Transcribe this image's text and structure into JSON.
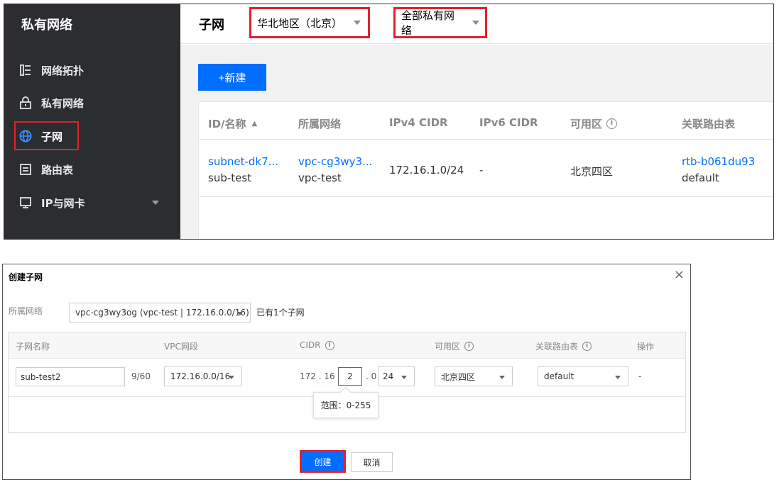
{
  "sidebar": {
    "title": "私有网络",
    "items": [
      {
        "label": "网络拓扑",
        "icon": "topology-icon"
      },
      {
        "label": "私有网络",
        "icon": "lock-icon"
      },
      {
        "label": "子网",
        "icon": "globe-icon"
      },
      {
        "label": "路由表",
        "icon": "route-table-icon"
      },
      {
        "label": "IP与网卡",
        "icon": "network-card-icon"
      }
    ]
  },
  "header": {
    "title": "子网",
    "region": "华北地区（北京）",
    "vpc_filter": "全部私有网络"
  },
  "toolbar": {
    "new_label": "+新建"
  },
  "table": {
    "columns": [
      "ID/名称",
      "所属网络",
      "IPv4 CIDR",
      "IPv6 CIDR",
      "可用区",
      "关联路由表"
    ],
    "rows": [
      {
        "id": "subnet-dk7...",
        "name": "sub-test",
        "vpc_id": "vpc-cg3wy3...",
        "vpc_name": "vpc-test",
        "ipv4": "172.16.1.0/24",
        "ipv6": "-",
        "zone": "北京四区",
        "route_table_id": "rtb-b061du93",
        "route_table_name": "default"
      }
    ]
  },
  "dialog": {
    "title": "创建子网",
    "close": "×",
    "vpc_label": "所属网络",
    "vpc_value": "vpc-cg3wy3og (vpc-test | 172.16.0.0/16)",
    "subnet_count": "已有1个子网",
    "columns": [
      "子网名称",
      "VPC网段",
      "CIDR",
      "可用区",
      "关联路由表",
      "操作"
    ],
    "row": {
      "name": "sub-test2",
      "name_count": "9/60",
      "vpc_cidr": "172.16.0.0/16",
      "cidr_prefix": "172 . 16 .",
      "cidr_third": "2",
      "cidr_suffix": ". 0 /",
      "mask": "24",
      "zone": "北京四区",
      "route_table": "default",
      "op": "-"
    },
    "tooltip": "范围：0-255",
    "create_label": "创建",
    "cancel_label": "取消"
  },
  "colors": {
    "accent": "#006eff",
    "highlight": "#e1222c",
    "sidebar_bg": "#2b2d31"
  }
}
